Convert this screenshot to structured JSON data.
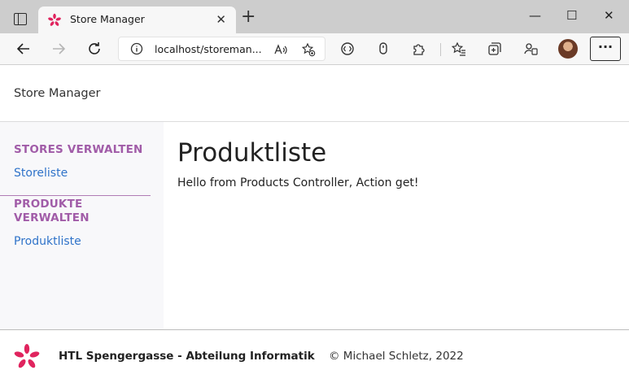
{
  "browser": {
    "tab": {
      "title": "Store Manager",
      "close": "✕"
    },
    "new_tab": "+",
    "window": {
      "minimize": "—",
      "maximize": "☐",
      "close": "✕"
    },
    "address": {
      "url": "localhost/storeman..."
    },
    "more": "···"
  },
  "app": {
    "brand": "Store Manager",
    "sidebar": {
      "sections": [
        {
          "heading": "STORES VERWALTEN",
          "links": [
            "Storeliste"
          ]
        },
        {
          "heading_line1": "PRODUKTE",
          "heading_line2": "VERWALTEN",
          "links": [
            "Produktliste"
          ]
        }
      ]
    },
    "main": {
      "title": "Produktliste",
      "text": "Hello from Products Controller, Action get!"
    },
    "footer": {
      "school": "HTL Spengergasse - Abteilung Informatik",
      "copyright": "© Michael Schletz, 2022"
    }
  },
  "colors": {
    "accent_purple": "#a15ca8",
    "link_blue": "#2f73c9",
    "logo_pink": "#e0245e"
  },
  "icons": [
    "tab-actions-icon",
    "favicon-icon",
    "back-icon",
    "forward-icon",
    "refresh-icon",
    "info-icon",
    "read-aloud-icon",
    "add-favorite-icon",
    "tracking-icon",
    "extension-icon",
    "puzzle-icon",
    "favorites-icon",
    "collections-icon",
    "profile-sync-icon",
    "avatar",
    "more-icon"
  ]
}
